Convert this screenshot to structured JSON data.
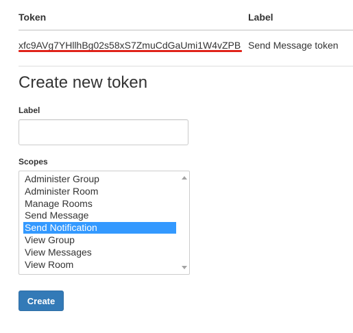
{
  "tokens_table": {
    "headers": {
      "token": "Token",
      "label": "Label"
    },
    "rows": [
      {
        "token": "xfc9AVg7YHllhBg02s58xS7ZmuCdGaUmi1W4vZPB",
        "label": "Send Message token"
      }
    ],
    "highlight_color": "#e0231a"
  },
  "form": {
    "title": "Create new token",
    "label_field": {
      "caption": "Label",
      "value": "",
      "placeholder": ""
    },
    "scopes_field": {
      "caption": "Scopes",
      "options": [
        "Administer Group",
        "Administer Room",
        "Manage Rooms",
        "Send Message",
        "Send Notification",
        "View Group",
        "View Messages",
        "View Room"
      ],
      "selected": "Send Notification"
    },
    "submit_label": "Create"
  },
  "colors": {
    "primary_button": "#337ab7",
    "selection": "#3399ff"
  }
}
